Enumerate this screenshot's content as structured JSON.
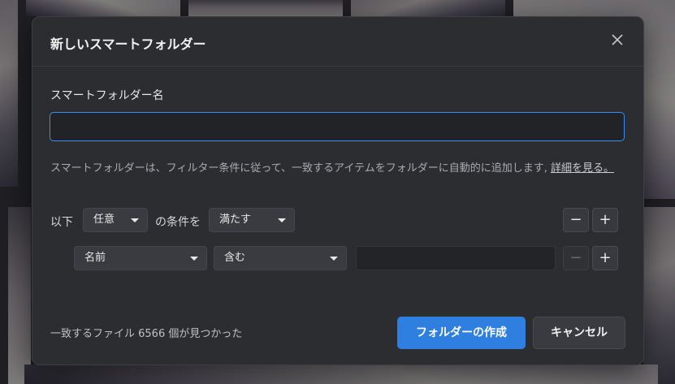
{
  "dialog": {
    "title": "新しいスマートフォルダー",
    "name_label": "スマートフォルダー名",
    "name_value": "",
    "description": "スマートフォルダーは、フィルター条件に従って、一致するアイテムをフォルダーに自動的に追加します,",
    "learn_more": "詳細を見る。",
    "condition_row": {
      "prefix": "以下",
      "match_select": "任意",
      "middle": "の条件を",
      "satisfy_select": "満たす",
      "remove_label": "−",
      "add_label": "+"
    },
    "rule_row": {
      "field_select": "名前",
      "operator_select": "含む",
      "value": "",
      "remove_label": "−",
      "add_label": "+"
    },
    "status": "一致するファイル 6566 個が見つかった",
    "create_button": "フォルダーの作成",
    "cancel_button": "キャンセル"
  },
  "colors": {
    "accent": "#2f7fe0",
    "dialog_bg": "#2c2d31",
    "input_focus": "#3d8ef0"
  },
  "icons": {
    "close": "close-icon"
  }
}
